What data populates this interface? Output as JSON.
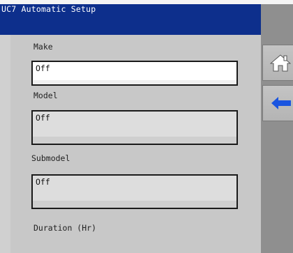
{
  "window": {
    "title": "UC7 Automatic Setup"
  },
  "fields": {
    "make": {
      "label": "Make",
      "value": "Off"
    },
    "model": {
      "label": "Model",
      "value": "Off"
    },
    "submodel": {
      "label": "Submodel",
      "value": "Off"
    },
    "duration": {
      "label": "Duration (Hr)"
    }
  },
  "sidebar": {
    "buttons": [
      {
        "icon": "home-icon"
      },
      {
        "icon": "back-arrow-icon"
      }
    ]
  },
  "colors": {
    "title_bar": "#0d2f8c",
    "content_bg": "#c8c8c8",
    "sidebar_bg": "#8f8f8f",
    "arrow": "#1a55e0"
  }
}
